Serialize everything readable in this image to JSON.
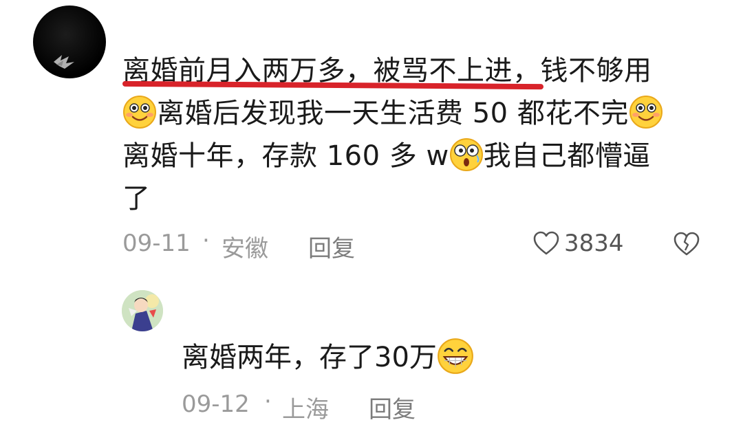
{
  "comment": {
    "line1_highlight": "离婚前月入两万多，被骂不上进",
    "line1_rest": "，钱不够用",
    "line2_text": "离婚后发现我一天生活费 50 都花不完",
    "line3_text_a": "离婚十年，存款 160 多 w",
    "line3_text_b": "我自己都懵逼",
    "line4_text": "了",
    "date": "09-11",
    "separator": "·",
    "location": "安徽",
    "reply_label": "回复",
    "like_count": "3834",
    "icons": {
      "avatar": "black-avatar-icon",
      "emoji_1": "smile-emoji-icon",
      "emoji_2": "smile-emoji-icon",
      "emoji_3": "shocked-emoji-icon",
      "like": "heart-outline-icon",
      "dislike": "broken-heart-icon"
    },
    "underline_color": "#d8232a"
  },
  "reply": {
    "text": "离婚两年，存了30万",
    "date": "09-12",
    "separator": "·",
    "location": "上海",
    "reply_label": "回复",
    "icons": {
      "avatar": "cartoon-avatar-icon",
      "emoji": "grin-emoji-icon"
    }
  }
}
